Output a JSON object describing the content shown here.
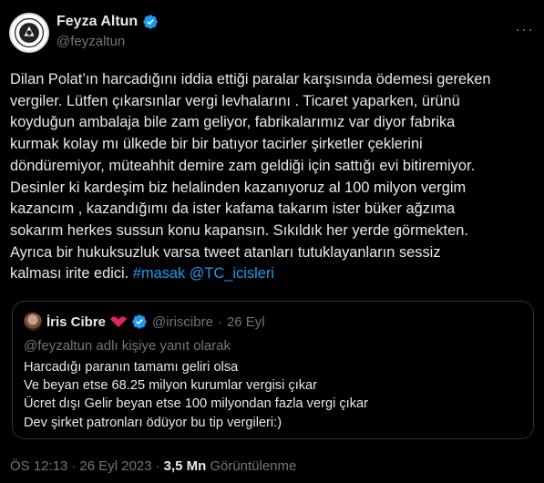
{
  "author": {
    "name": "Feyza Altun",
    "handle": "@feyzaltun"
  },
  "tweet": {
    "lines": [
      "Dilan Polat’ın harcadığını iddia ettiği paralar karşısında ödemesi gereken",
      "vergiler. Lütfen çıkarsınlar vergi levhalarını . Ticaret yaparken, ürünü",
      "koyduğun ambalaja bile zam geliyor, fabrikalarımız var diyor fabrika",
      "kurmak kolay mı ülkede bir bir batıyor tacirler şirketler çeklerini",
      "döndüremiyor, müteahhit demire zam geldiği için sattığı evi bitiremiyor.",
      "Desinler ki  kardeşim biz helalinden kazanıyoruz al 100 milyon vergim",
      "kazancım , kazandığımı da ister kafama takarım ister büker ağzıma",
      "sokarım herkes sussun konu kapansın. Sıkıldık her yerde görmekten.",
      "Ayrıca bir hukuksuzluk varsa tweet atanları tutuklayanların sessiz"
    ],
    "last_line_text": "kalması irite edici.",
    "hashtag": "#masak",
    "mention": "@TC_icisleri"
  },
  "quote": {
    "name": "İris Cibre",
    "handle": "@iriscibre",
    "separator": "·",
    "date": "26 Eyl",
    "reply_to": "@feyzaltun adlı kişiye yanıt olarak",
    "lines": [
      "Harcadığı paranın tamamı geliri olsa",
      "Ve beyan etse 68.25 milyon kurumlar vergisi çıkar",
      "Ücret dışı Gelir beyan etse 100 milyondan fazla vergi çıkar",
      "Dev şirket patronları ödüyor bu tip vergileri:)"
    ]
  },
  "footer": {
    "time": "ÖS 12:13",
    "separator1": "·",
    "date": "26 Eyl 2023",
    "separator2": "·",
    "views": "3,5 Mn",
    "views_label": "Görüntülenme"
  },
  "more_icon": "more-horizontal-icon",
  "colors": {
    "background": "#000000",
    "text": "#e7e9ea",
    "muted": "#71767b",
    "link": "#1d9bf0",
    "border": "#2f3336"
  }
}
